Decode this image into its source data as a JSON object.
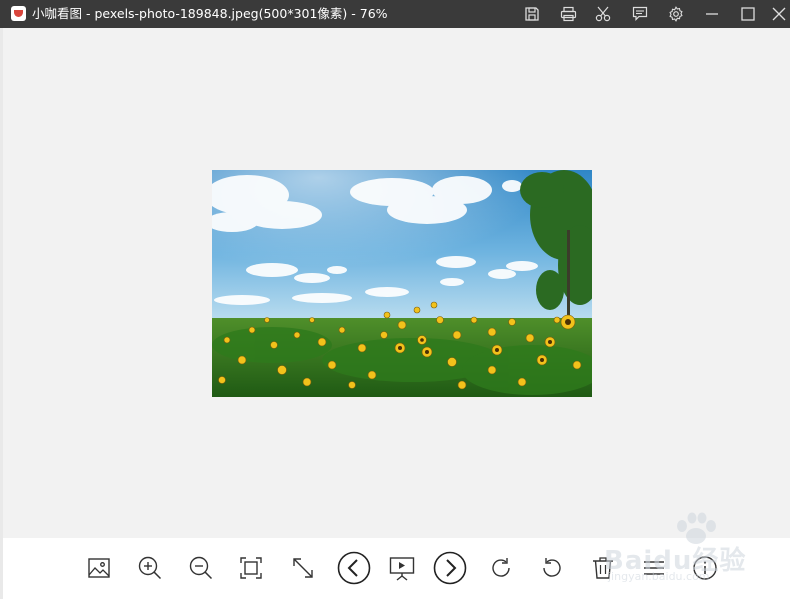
{
  "window": {
    "title": "小咖看图 - pexels-photo-189848.jpeg(500*301像素) - 76%",
    "controls": [
      "save-icon",
      "print-icon",
      "cut-icon",
      "comment-icon",
      "settings-icon",
      "minimize-icon",
      "maximize-icon",
      "close-icon"
    ]
  },
  "viewer": {
    "image_description_icon": "sunflower-field-photo"
  },
  "toolbar": {
    "tools": [
      "image-icon",
      "zoom-in-icon",
      "zoom-out-icon",
      "fit-icon",
      "fullsize-icon",
      "prev-icon",
      "slideshow-icon",
      "next-icon",
      "rotate-cw-icon",
      "rotate-ccw-icon",
      "delete-icon",
      "menu-icon",
      "info-icon"
    ]
  },
  "watermark": {
    "brand": "Baidu经验",
    "url": "jingyan.baidu.com"
  },
  "colors": {
    "titlebar": "#3a3a3a",
    "canvas": "#f2f2f2",
    "toolbar": "#ffffff",
    "icon": "#333333"
  }
}
